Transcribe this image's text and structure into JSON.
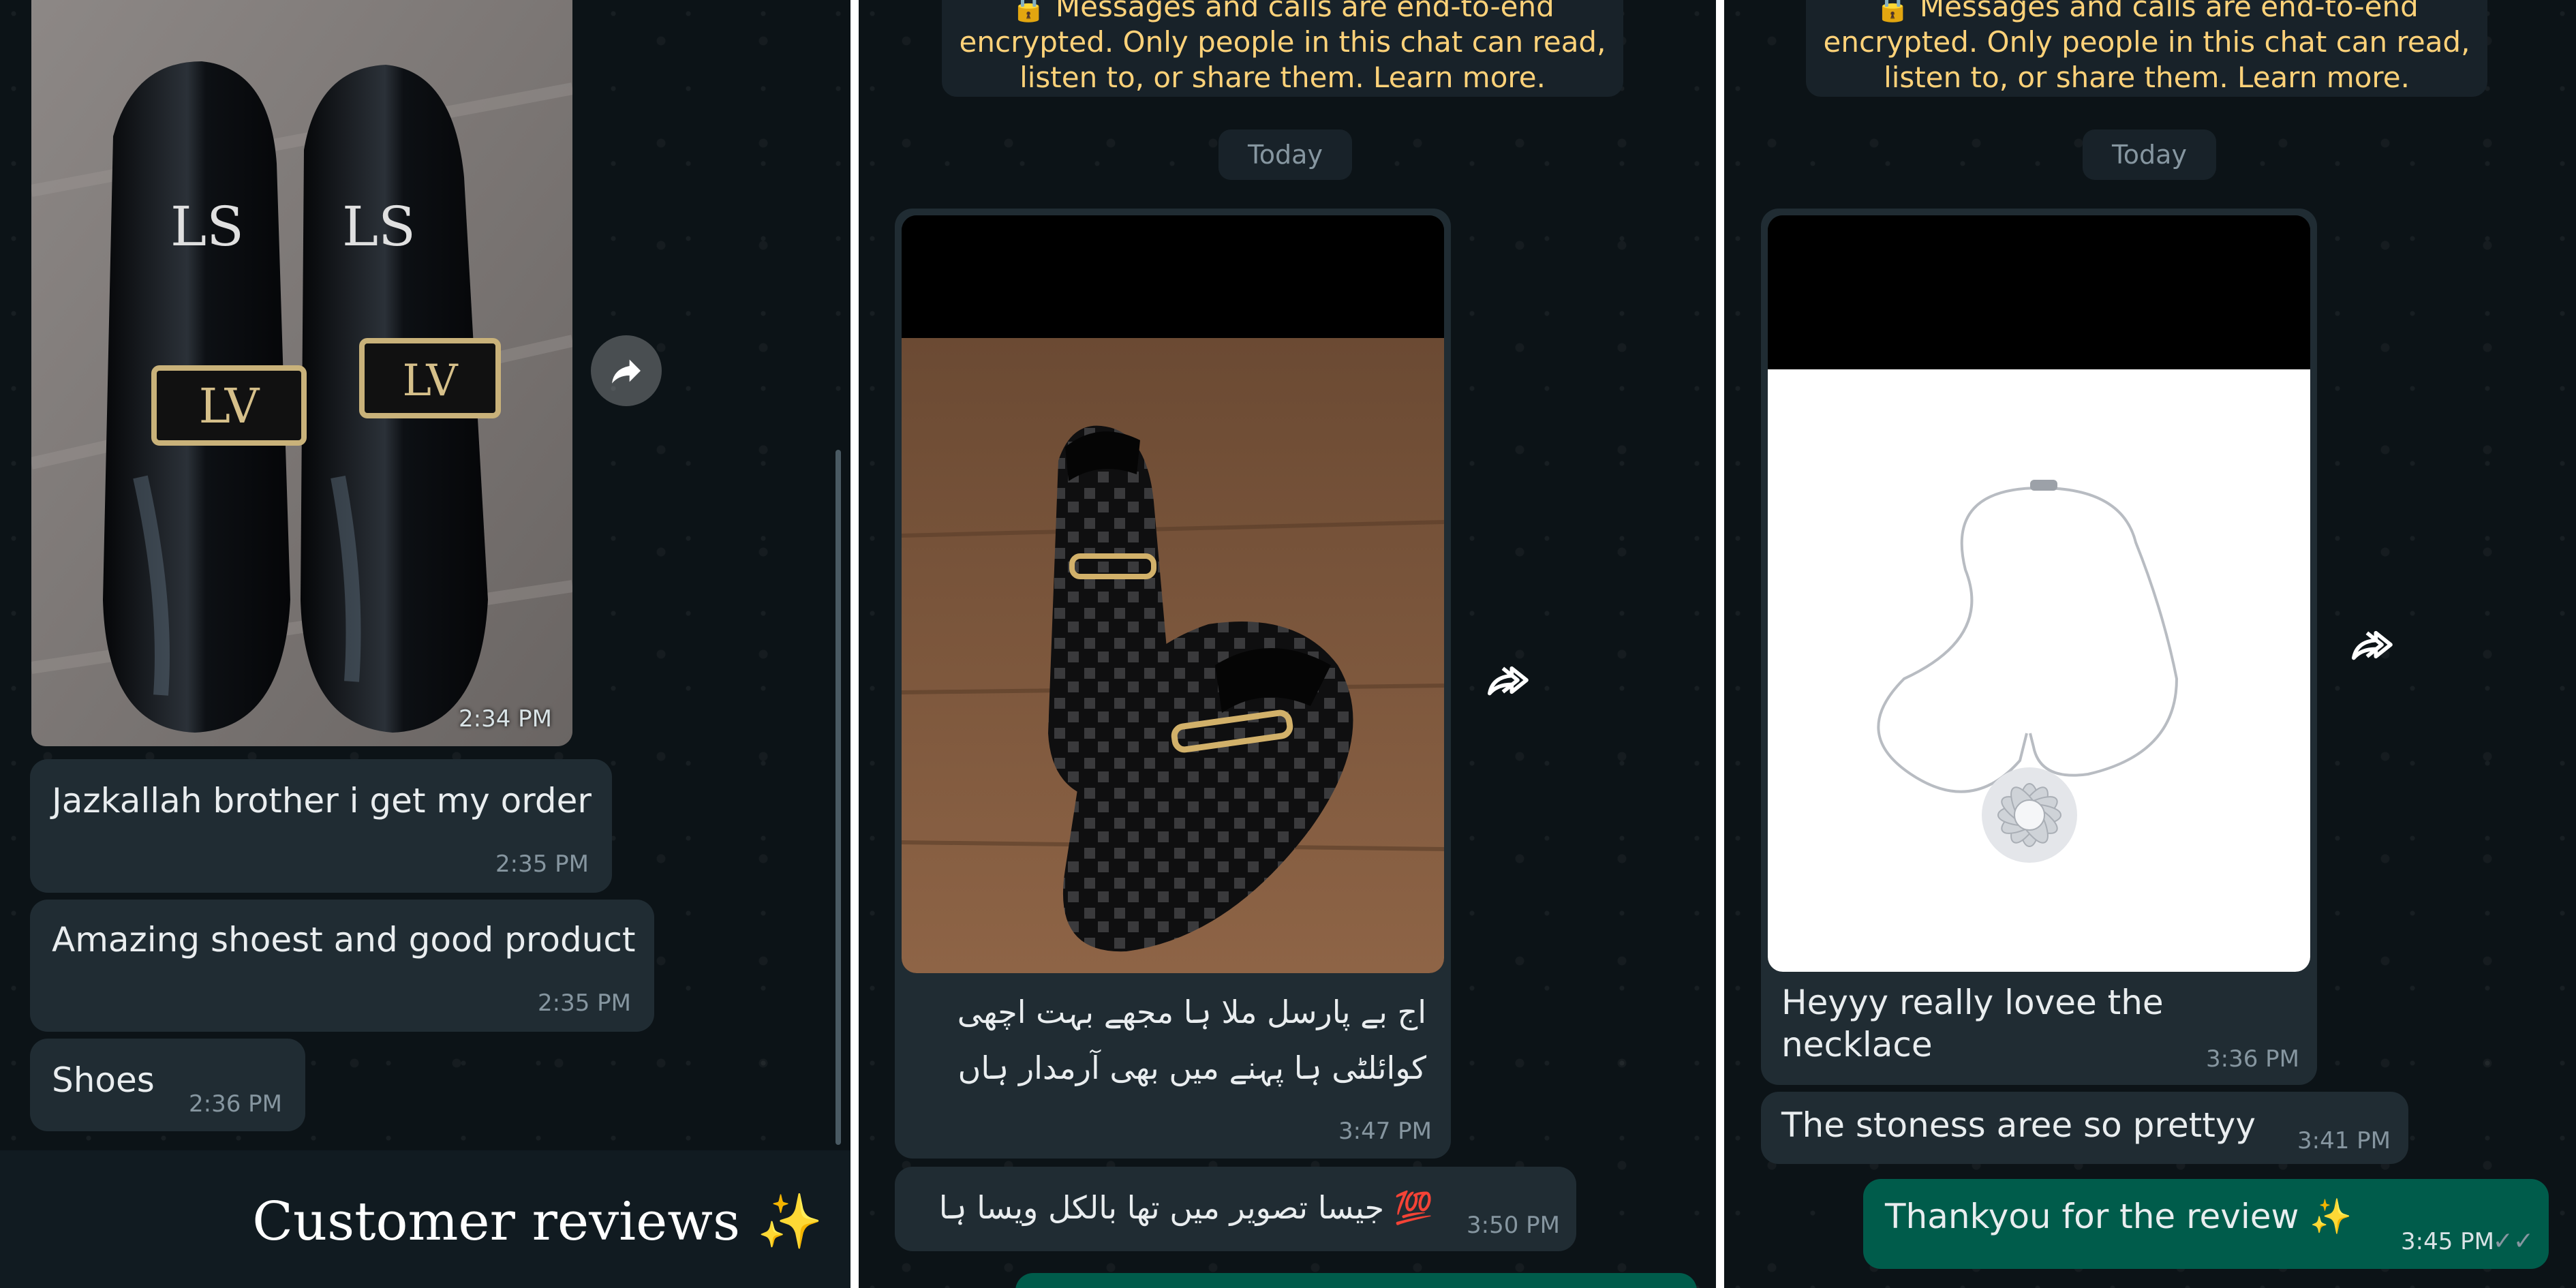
{
  "panel1": {
    "image_time": "2:34 PM",
    "messages": [
      {
        "text": "Jazkallah brother i get my order",
        "time": "2:35 PM"
      },
      {
        "text": "Amazing shoest and good product",
        "time": "2:35 PM"
      },
      {
        "text": "Shoes",
        "time": "2:36 PM"
      }
    ],
    "caption": "Customer reviews ✨"
  },
  "panel2": {
    "encryption_notice": "🔒 Messages and calls are end-to-end encrypted. Only people in this chat can read, listen to, or share them. Learn more.",
    "date_label": "Today",
    "image_caption": "اج بے پارسل ملا ہا مجھے بہت اچھی کوائلٹی ہا پہنے میں بھی آرمدار ہاں",
    "image_caption_time": "3:47 PM",
    "message2": {
      "text": "💯 جیسا تصویر میں تھا بالکل ویسا ہا",
      "time": "3:50 PM"
    }
  },
  "panel3": {
    "encryption_notice": "🔒 Messages and calls are end-to-end encrypted. Only people in this chat can read, listen to, or share them. Learn more.",
    "date_label": "Today",
    "image_caption": "Heyyy really lovee the necklace",
    "image_caption_time": "3:36 PM",
    "message2": {
      "text": "The stoness aree so prettyy",
      "time": "3:41 PM"
    },
    "reply": {
      "text": "Thankyou for the review ✨",
      "time": "3:45 PM",
      "status": "✓✓"
    }
  },
  "colors": {
    "chat_bg": "#0c1317",
    "incoming_bubble": "#202c33",
    "outgoing_bubble": "#005c4b",
    "encryption_text": "#ffd279",
    "timestamp": "#8696a0"
  },
  "icons": [
    "forward-icon",
    "lock-icon",
    "double-check-icon",
    "sparkles-icon"
  ]
}
